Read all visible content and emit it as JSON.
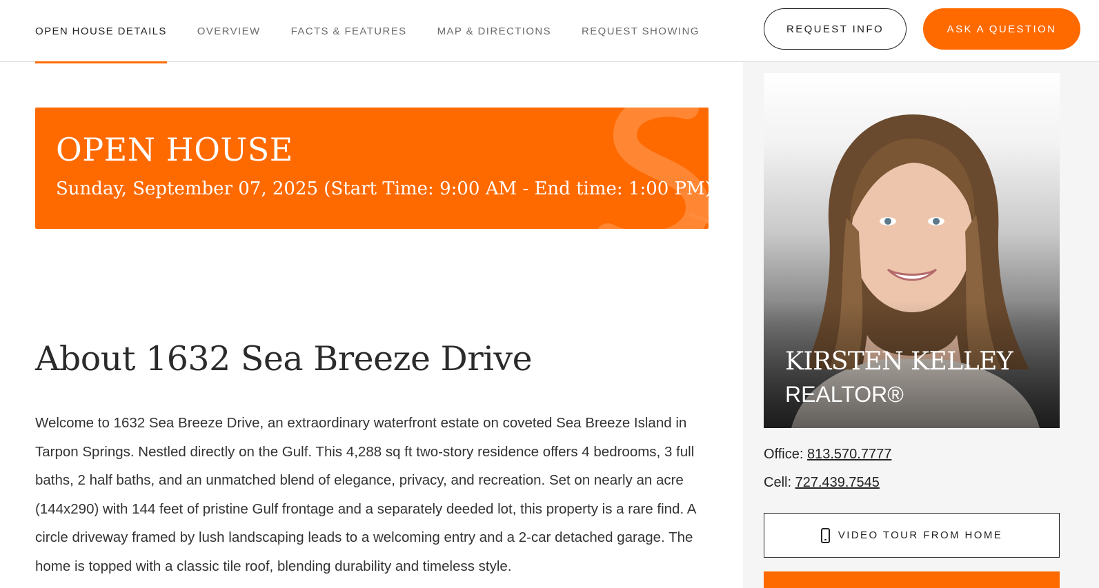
{
  "nav": {
    "tabs": [
      {
        "label": "OPEN HOUSE DETAILS",
        "active": true
      },
      {
        "label": "OVERVIEW",
        "active": false
      },
      {
        "label": "FACTS & FEATURES",
        "active": false
      },
      {
        "label": "MAP & DIRECTIONS",
        "active": false
      },
      {
        "label": "REQUEST SHOWING",
        "active": false
      }
    ],
    "request_info_label": "REQUEST INFO",
    "ask_question_label": "ASK A QUESTION"
  },
  "banner": {
    "title": "OPEN HOUSE",
    "date_line": "Sunday, September 07, 2025 (Start Time: 9:00 AM - End time: 1:00 PM)"
  },
  "about": {
    "title": "About 1632 Sea Breeze Drive",
    "body": "Welcome to 1632 Sea Breeze Drive, an extraordinary waterfront estate on coveted Sea Breeze Island in Tarpon Springs. Nestled directly on the Gulf. This 4,288 sq ft two-story residence offers 4 bedrooms, 3 full baths, 2 half baths, and an unmatched blend of elegance, privacy, and recreation. Set on nearly an acre (144x290) with 144 feet of pristine Gulf frontage and a separately deeded lot, this property is a rare find. A circle driveway framed by lush landscaping leads to a welcoming entry and a 2-car detached garage. The home is topped with a classic tile roof, blending durability and timeless style."
  },
  "agent": {
    "name": "KIRSTEN KELLEY",
    "role": "REALTOR®",
    "office_label": "Office:",
    "office_phone": "813.570.7777",
    "cell_label": "Cell:",
    "cell_phone": "727.439.7545",
    "video_tour_label": "VIDEO TOUR FROM HOME"
  },
  "colors": {
    "accent": "#ff6a00",
    "text": "#333333",
    "sidebar_bg": "#f5f5f5"
  }
}
